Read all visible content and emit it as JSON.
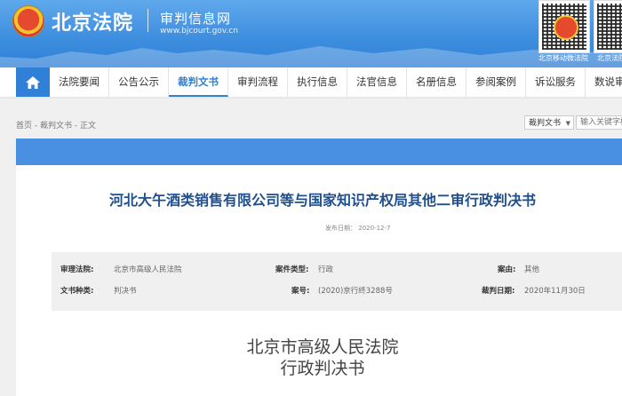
{
  "header": {
    "site_name": "北京法院",
    "sub_title": "审判信息网",
    "sub_url": "www.bjcourt.gov.cn",
    "qr_captions": [
      "北京移动微法院",
      "北京法院"
    ]
  },
  "nav": {
    "items": [
      {
        "label": "法院要闻"
      },
      {
        "label": "公告公示"
      },
      {
        "label": "裁判文书",
        "active": true
      },
      {
        "label": "审判流程"
      },
      {
        "label": "执行信息"
      },
      {
        "label": "法官信息"
      },
      {
        "label": "名册信息"
      },
      {
        "label": "参阅案例"
      },
      {
        "label": "诉讼服务"
      },
      {
        "label": "数说审判"
      }
    ]
  },
  "breadcrumb": "首页 - 裁判文书 - 正文",
  "search": {
    "filter_value": "裁判文书",
    "placeholder": "输入关键字检索"
  },
  "document": {
    "title": "河北大午酒类销售有限公司等与国家知识产权局其他二审行政判决书",
    "publish_date_label": "发布日期：",
    "publish_date": "2020-12-7",
    "meta": {
      "court_label": "审理法院:",
      "court": "北京市高级人民法院",
      "case_type_label": "案件类型:",
      "case_type": "行政",
      "cause_label": "案由:",
      "cause": "其他",
      "doc_type_label": "文书种类:",
      "doc_type": "判决书",
      "case_no_label": "案号:",
      "case_no": "(2020)京行终3288号",
      "judge_date_label": "裁判日期:",
      "judge_date": "2020年11月30日"
    },
    "court_name": "北京市高级人民法院",
    "doc_kind": "行政判决书"
  },
  "colors": {
    "header_blue": "#3f8fe0",
    "nav_active": "#2f80d6",
    "title_blue": "#1f4f8c"
  }
}
